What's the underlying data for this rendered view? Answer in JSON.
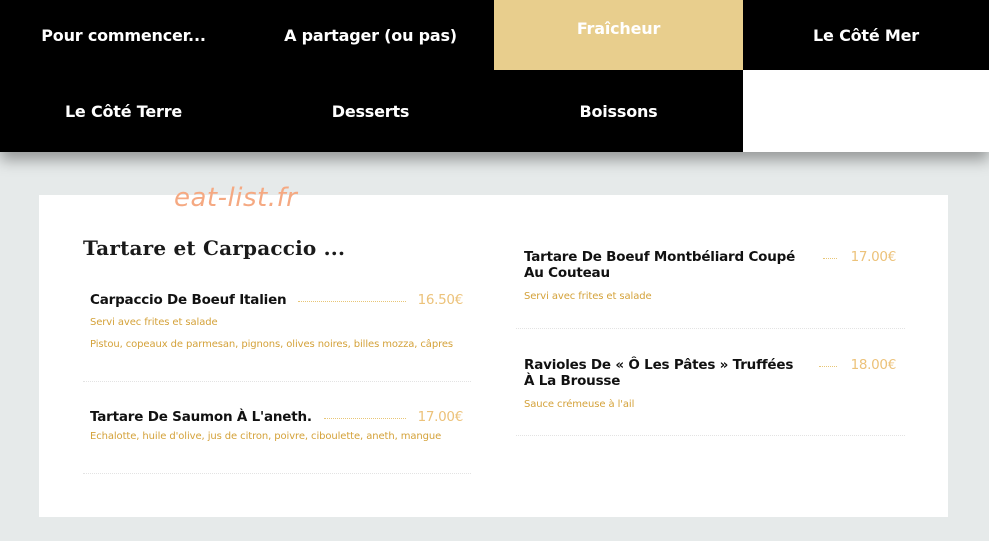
{
  "nav": {
    "items": [
      {
        "label": "Pour commencer..."
      },
      {
        "label": "A partager (ou pas)"
      },
      {
        "label": "Fraîcheur"
      },
      {
        "label": "Le Côté Mer"
      },
      {
        "label": "Le Côté Terre"
      },
      {
        "label": "Desserts"
      },
      {
        "label": "Boissons"
      }
    ],
    "active_index": 2
  },
  "watermark": "eat-list.fr",
  "section": {
    "title": "Tartare et Carpaccio ..."
  },
  "dishes": [
    {
      "name": "Carpaccio De Boeuf Italien",
      "price": "16.50€",
      "desc_1": "Servi avec frites et salade",
      "desc_2": "Pistou, copeaux de parmesan, pignons, olives noires, billes mozza, câpres"
    },
    {
      "name": "Tartare De Saumon À L'aneth.",
      "price": "17.00€",
      "desc_1": "Echalotte, huile d'olive, jus de citron, poivre, ciboulette, aneth, mangue"
    },
    {
      "name_line_1": "Tartare De Boeuf Montbéliard Coupé",
      "name_line_2": "Au Couteau",
      "price": "17.00€",
      "desc_1": "Servi avec frites et salade"
    },
    {
      "name_line_1": "Ravioles De « Ô Les Pâtes » Truffées",
      "name_line_2": "À La Brousse",
      "price": "18.00€",
      "desc_1": "Sauce crémeuse à l'ail"
    }
  ],
  "colors": {
    "nav_bg": "#000000",
    "nav_active_bg": "#e8ce8d",
    "price": "#ecc27a",
    "description": "#d4a23a",
    "watermark": "#f5a982"
  }
}
